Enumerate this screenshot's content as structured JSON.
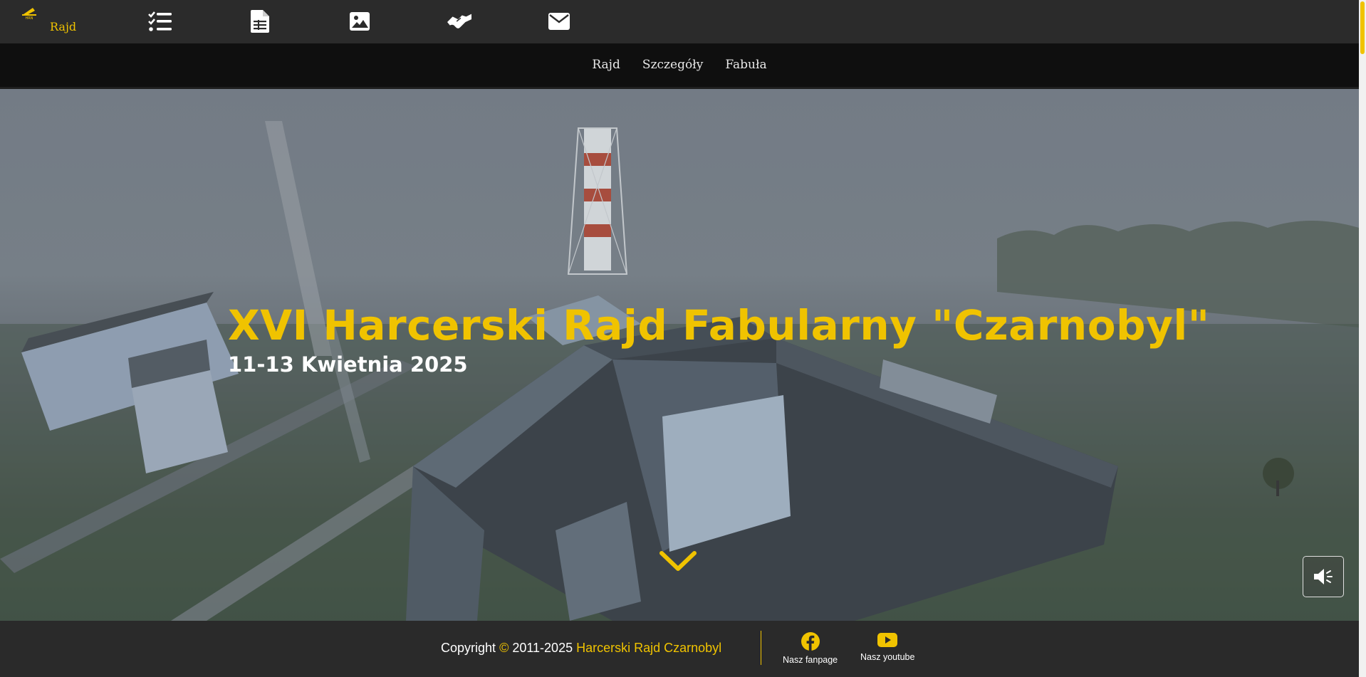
{
  "brand": {
    "label": "Rajd",
    "logo_icon": "radiation-logo-icon"
  },
  "topbar": {
    "icons": [
      "checklist-icon",
      "document-icon",
      "image-icon",
      "handshake-icon",
      "envelope-icon"
    ]
  },
  "subnav": {
    "items": [
      "Rajd",
      "Szczegóły",
      "Fabuła"
    ]
  },
  "hero": {
    "title": "XVI Harcerski Rajd Fabularny \"Czarnobyl\"",
    "date": "11-13 Kwietnia 2025",
    "scroll_icon": "chevron-down-icon",
    "sound_icon": "speaker-icon"
  },
  "footer": {
    "copyright_prefix": "Copyright",
    "copyright_symbol": "©",
    "years": "2011-2025",
    "org_name": "Harcerski Rajd Czarnobyl",
    "social": [
      {
        "label": "Nasz fanpage",
        "icon": "facebook-icon"
      },
      {
        "label": "Nasz youtube",
        "icon": "youtube-icon"
      }
    ]
  },
  "colors": {
    "accent": "#f0c300",
    "topbar": "#2b2b2b",
    "subnav": "#0f0f0f",
    "footer": "#2a2a2a"
  }
}
